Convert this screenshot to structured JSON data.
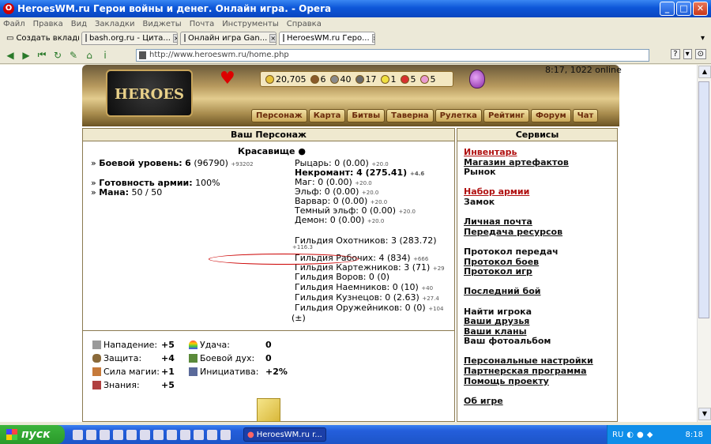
{
  "window": {
    "title": "HeroesWM.ru Герои войны и денег. Онлайн игра. - Opera"
  },
  "menubar": [
    "Файл",
    "Правка",
    "Вид",
    "Закладки",
    "Виджеты",
    "Почта",
    "Инструменты",
    "Справка"
  ],
  "tabs": [
    {
      "label": "Создать вкладку",
      "active": false
    },
    {
      "label": "bash.org.ru - Цита...",
      "active": false
    },
    {
      "label": "Онлайн игра Gan...",
      "active": false
    },
    {
      "label": "HeroesWM.ru Геро...",
      "active": true
    }
  ],
  "address": {
    "url": "http://www.heroeswm.ru/home.php"
  },
  "game": {
    "logo_text": "HEROES",
    "online": "8:17, 1022 online",
    "resources": [
      "20,705",
      "6",
      "40",
      "17",
      "1",
      "5",
      "5"
    ],
    "nav": [
      "Персонаж",
      "Карта",
      "Битвы",
      "Таверна",
      "Рулетка",
      "Рейтинг",
      "Форум",
      "Чат"
    ]
  },
  "character_panel": {
    "title": "Ваш Персонаж",
    "name": "Красавище",
    "combat_level_label": "Боевой уровень:",
    "combat_level_value": "6",
    "combat_level_exp": "(96790)",
    "combat_level_next": "+93202",
    "army_label": "Готовность армии:",
    "army_value": "100%",
    "mana_label": "Мана:",
    "mana_value": "50 / 50",
    "factions": [
      {
        "text": "Рыцарь: 0 (0.00)",
        "small": "+20.0"
      },
      {
        "text": "Некромант: 4 (275.41)",
        "small": "+4.6"
      },
      {
        "text": "Маг: 0 (0.00)",
        "small": "+20.0"
      },
      {
        "text": "Эльф: 0 (0.00)",
        "small": "+20.0"
      },
      {
        "text": "Варвар: 0 (0.00)",
        "small": "+20.0"
      },
      {
        "text": "Темный эльф: 0 (0.00)",
        "small": "+20.0"
      },
      {
        "text": "Демон: 0 (0.00)",
        "small": "+20.0"
      }
    ],
    "guilds": [
      {
        "text": "Гильдия Охотников: 3 (283.72)",
        "small": ""
      },
      {
        "text": "Гильдия Рабочих: 4 (834)",
        "small": "+666"
      },
      {
        "text": "Гильдия Картежников: 3 (71)",
        "small": "+29"
      },
      {
        "text": "Гильдия Воров: 0 (0)",
        "small": ""
      },
      {
        "text": "Гильдия Наемников: 0 (10)",
        "small": "+40"
      },
      {
        "text": "Гильдия Кузнецов: 0 (2.63)",
        "small": "+27.4"
      },
      {
        "text": "Гильдия Оружейников: 0 (0)",
        "small": "+104"
      }
    ],
    "hunters_small": "+116.3",
    "toggle": "(±)"
  },
  "stats": {
    "attack_label": "Нападение:",
    "attack_value": "+5",
    "defense_label": "Защита:",
    "defense_value": "+4",
    "spell_label": "Сила магии:",
    "spell_value": "+1",
    "knowledge_label": "Знания:",
    "knowledge_value": "+5",
    "luck_label": "Удача:",
    "luck_value": "0",
    "morale_label": "Боевой дух:",
    "morale_value": "0",
    "initiative_label": "Инициатива:",
    "initiative_value": "+2%"
  },
  "services": {
    "title": "Сервисы",
    "groups": [
      [
        {
          "label": "Инвентарь",
          "red": true
        },
        {
          "label": "Магазин артефактов"
        },
        {
          "label": "Рынок",
          "plain": true
        }
      ],
      [
        {
          "label": "Набор армии",
          "red": true
        },
        {
          "label": "Замок",
          "plain": true
        }
      ],
      [
        {
          "label": "Личная почта"
        },
        {
          "label": "Передача ресурсов"
        }
      ],
      [
        {
          "label": "Протокол передач",
          "plain": true
        },
        {
          "label": "Протокол боев"
        },
        {
          "label": "Протокол игр"
        }
      ],
      [
        {
          "label": "Последний бой"
        }
      ],
      [
        {
          "label": "Найти игрока",
          "plain": true
        },
        {
          "label": "Ваши друзья"
        },
        {
          "label": "Ваши кланы"
        },
        {
          "label": "Ваш фотоальбом",
          "plain": true
        }
      ],
      [
        {
          "label": "Персональные настройки"
        },
        {
          "label": "Партнерская программа"
        },
        {
          "label": "Помощь проекту"
        }
      ],
      [
        {
          "label": "Об игре"
        }
      ]
    ]
  },
  "taskbar": {
    "start": "пуск",
    "task": "HeroesWM.ru r...",
    "lang": "RU",
    "clock": "8:18"
  }
}
